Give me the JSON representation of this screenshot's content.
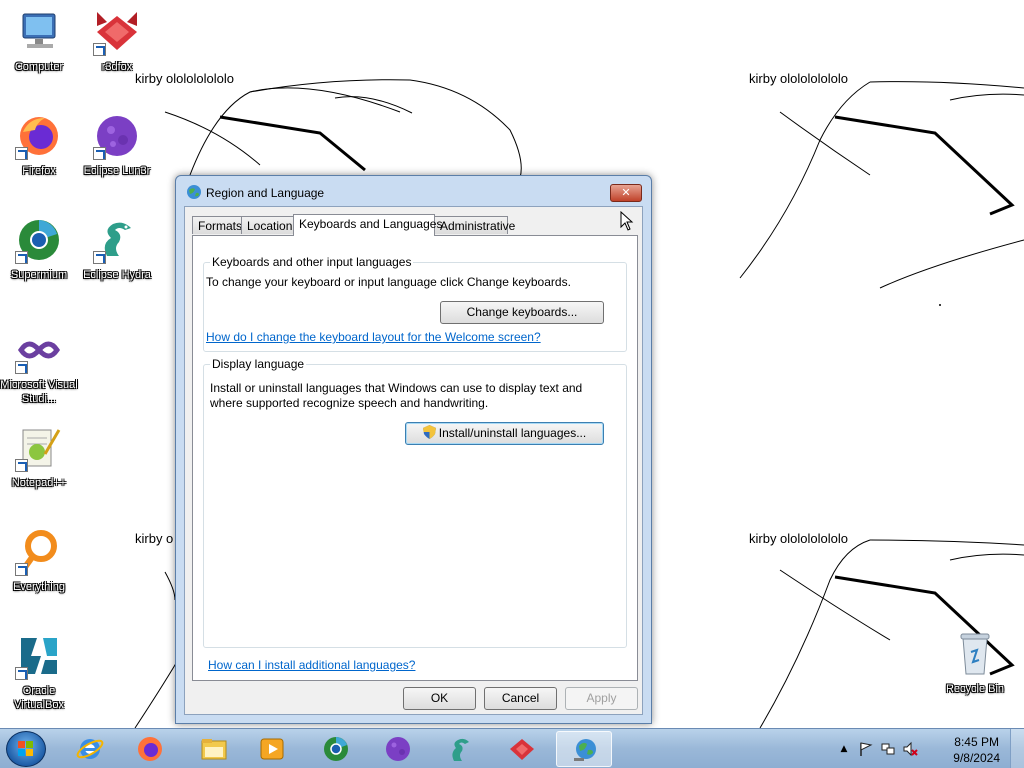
{
  "wallpaper": {
    "caption": "kirby ololololololo",
    "caption_clipped": "kirby o"
  },
  "desktop_icons": [
    {
      "label": "Computer"
    },
    {
      "label": "r3dfox"
    },
    {
      "label": "Firefox"
    },
    {
      "label": "Eclipse Lun3r"
    },
    {
      "label": "Supermium"
    },
    {
      "label": "Eclipse Hydra"
    },
    {
      "label": "Microsoft Visual Studi..."
    },
    {
      "label": "Notepad++"
    },
    {
      "label": "Everything"
    },
    {
      "label": "Oracle VirtualBox"
    },
    {
      "label": "Recycle Bin"
    }
  ],
  "dialog": {
    "title": "Region and Language",
    "close_label": "✕",
    "tabs": [
      {
        "label": "Formats",
        "active": false
      },
      {
        "label": "Location",
        "active": false
      },
      {
        "label": "Keyboards and Languages",
        "active": true
      },
      {
        "label": "Administrative",
        "active": false
      }
    ],
    "keyboards_group": {
      "title": "Keyboards and other input languages",
      "description": "To change your keyboard or input language click Change keyboards.",
      "button": "Change keyboards...",
      "link": "How do I change the keyboard layout for the Welcome screen?"
    },
    "display_group": {
      "title": "Display language",
      "description_line1": "Install or uninstall languages that Windows can use to display text and",
      "description_line2": "where supported recognize speech and handwriting.",
      "button": "Install/uninstall languages..."
    },
    "help_link": "How can I install additional languages?",
    "buttons": {
      "ok": "OK",
      "cancel": "Cancel",
      "apply": "Apply"
    }
  },
  "taskbar": {
    "items": [
      {
        "icon": "internet-explorer-icon"
      },
      {
        "icon": "firefox-icon"
      },
      {
        "icon": "file-explorer-icon"
      },
      {
        "icon": "media-player-icon"
      },
      {
        "icon": "supermium-icon"
      },
      {
        "icon": "eclipse-icon"
      },
      {
        "icon": "eclipse-hydra-icon"
      },
      {
        "icon": "r3dfox-icon"
      },
      {
        "icon": "region-language-icon",
        "active": true
      }
    ],
    "clock": {
      "time": "8:45 PM",
      "date": "9/8/2024"
    },
    "tray_arrow": "▲"
  },
  "colors": {
    "link": "#0066cc",
    "taskbar": "#9ab8d8",
    "dialog_frame": "#c9dcf2"
  }
}
